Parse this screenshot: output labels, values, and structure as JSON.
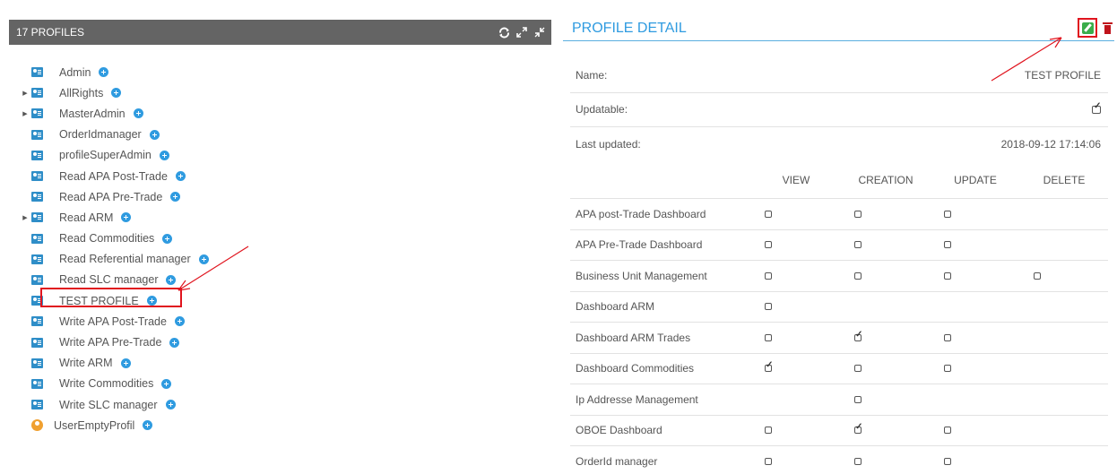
{
  "left_panel": {
    "header_title": "17 PROFILES",
    "tools": [
      "refresh-icon",
      "expand-icon",
      "collapse-icon"
    ],
    "profiles": [
      {
        "label": "Admin",
        "has_children": false,
        "icon": "profile-card-icon"
      },
      {
        "label": "AllRights",
        "has_children": true,
        "icon": "profile-card-icon"
      },
      {
        "label": "MasterAdmin",
        "has_children": true,
        "icon": "profile-card-icon"
      },
      {
        "label": "OrderIdmanager",
        "has_children": false,
        "icon": "profile-card-icon"
      },
      {
        "label": "profileSuperAdmin",
        "has_children": false,
        "icon": "profile-card-icon"
      },
      {
        "label": "Read APA Post-Trade",
        "has_children": false,
        "icon": "profile-card-icon"
      },
      {
        "label": "Read APA Pre-Trade",
        "has_children": false,
        "icon": "profile-card-icon"
      },
      {
        "label": "Read ARM",
        "has_children": true,
        "icon": "profile-card-icon"
      },
      {
        "label": "Read Commodities",
        "has_children": false,
        "icon": "profile-card-icon"
      },
      {
        "label": "Read Referential manager",
        "has_children": false,
        "icon": "profile-card-icon"
      },
      {
        "label": "Read SLC manager",
        "has_children": false,
        "icon": "profile-card-icon"
      },
      {
        "label": "TEST PROFILE",
        "has_children": false,
        "icon": "profile-card-icon",
        "selected": true
      },
      {
        "label": "Write APA Post-Trade",
        "has_children": false,
        "icon": "profile-card-icon"
      },
      {
        "label": "Write APA Pre-Trade",
        "has_children": false,
        "icon": "profile-card-icon"
      },
      {
        "label": "Write ARM",
        "has_children": false,
        "icon": "profile-card-icon"
      },
      {
        "label": "Write Commodities",
        "has_children": false,
        "icon": "profile-card-icon"
      },
      {
        "label": "Write SLC manager",
        "has_children": false,
        "icon": "profile-card-icon"
      },
      {
        "label": "UserEmptyProfil",
        "has_children": false,
        "icon": "user-icon"
      }
    ]
  },
  "right_panel": {
    "title": "PROFILE DETAIL",
    "actions": [
      "edit-icon",
      "trash-icon"
    ],
    "fields": {
      "name_label": "Name:",
      "name_value": "TEST PROFILE",
      "updatable_label": "Updatable:",
      "updatable_value": true,
      "last_updated_label": "Last updated:",
      "last_updated_value": "2018-09-12 17:14:06"
    },
    "permissions": {
      "columns": [
        "",
        "VIEW",
        "CREATION",
        "UPDATE",
        "DELETE"
      ],
      "rows": [
        {
          "name": "APA post-Trade Dashboard",
          "view": false,
          "creation": false,
          "update": false,
          "delete": null
        },
        {
          "name": "APA Pre-Trade Dashboard",
          "view": false,
          "creation": false,
          "update": false,
          "delete": null
        },
        {
          "name": "Business Unit Management",
          "view": false,
          "creation": false,
          "update": false,
          "delete": false
        },
        {
          "name": "Dashboard ARM",
          "view": false,
          "creation": null,
          "update": null,
          "delete": null
        },
        {
          "name": "Dashboard ARM Trades",
          "view": false,
          "creation": true,
          "update": false,
          "delete": null
        },
        {
          "name": "Dashboard Commodities",
          "view": true,
          "creation": false,
          "update": false,
          "delete": null
        },
        {
          "name": "Ip Addresse Management",
          "view": null,
          "creation": false,
          "update": null,
          "delete": null
        },
        {
          "name": "OBOE Dashboard",
          "view": false,
          "creation": true,
          "update": false,
          "delete": null
        },
        {
          "name": "OrderId manager",
          "view": false,
          "creation": false,
          "update": false,
          "delete": null
        }
      ]
    }
  },
  "colors": {
    "header_bg": "#646464",
    "accent_blue": "#2f9be0",
    "highlight_red": "#e0141e",
    "edit_green": "#3aad4b",
    "trash_red": "#c0131b"
  }
}
